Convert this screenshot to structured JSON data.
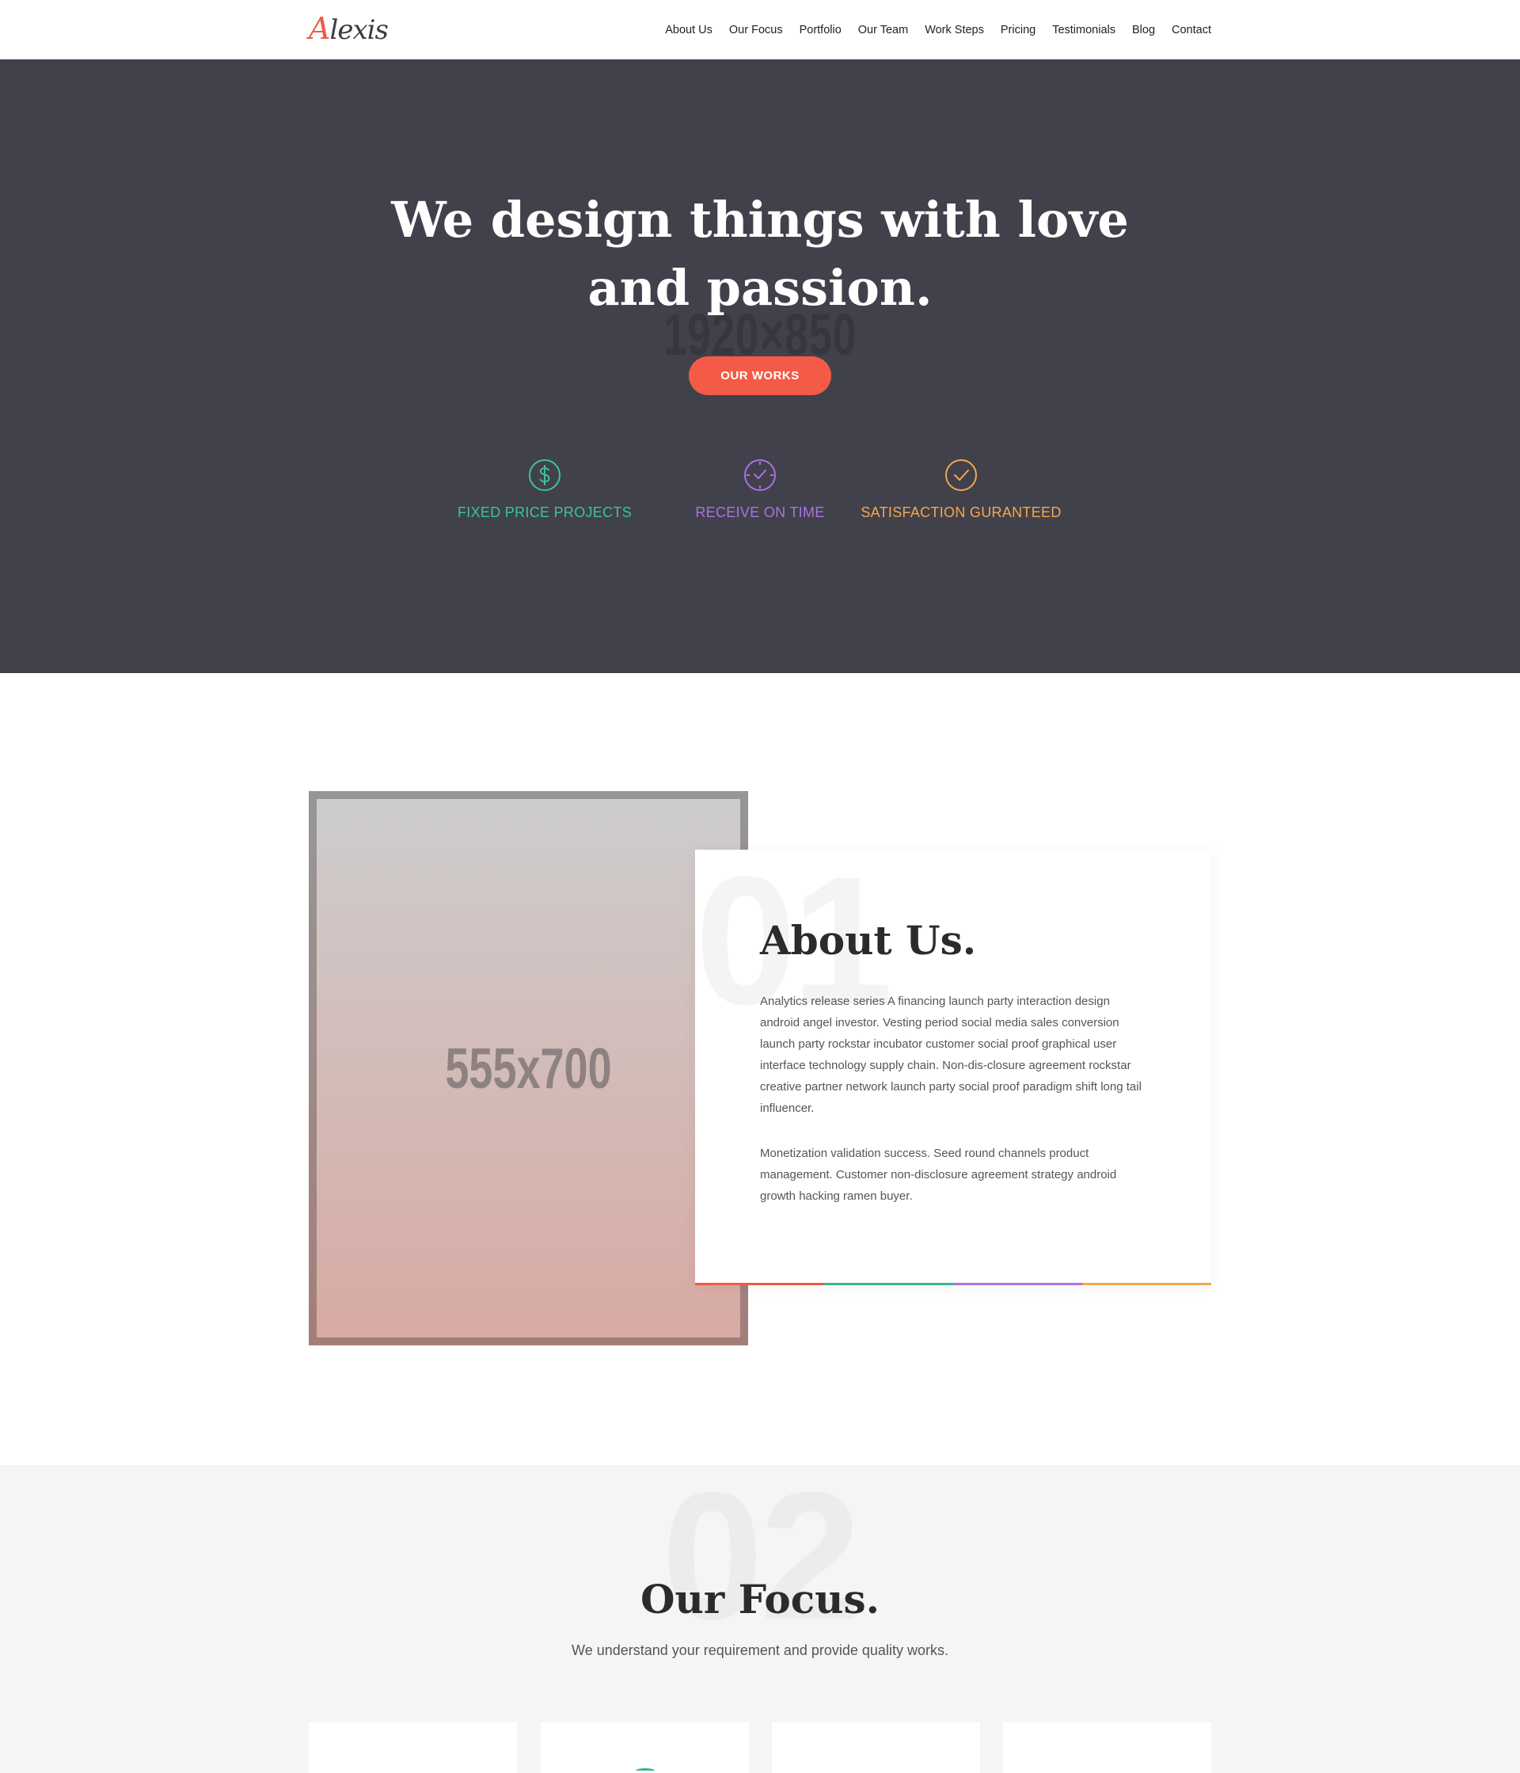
{
  "header": {
    "logo_first": "A",
    "logo_rest": "lexis",
    "nav": [
      "About Us",
      "Our Focus",
      "Portfolio",
      "Our Team",
      "Work Steps",
      "Pricing",
      "Testimonials",
      "Blog",
      "Contact"
    ]
  },
  "hero": {
    "placeholder": "1920×850",
    "title": "We design things with love and passion.",
    "cta": "OUR WORKS",
    "features": [
      {
        "label": "FIXED PRICE PROJECTS",
        "icon": "dollar-circle-icon",
        "color": "#3cc39d"
      },
      {
        "label": "RECEIVE ON TIME",
        "icon": "clock-check-icon",
        "color": "#a874e0"
      },
      {
        "label": "SATISFACTION GURANTEED",
        "icon": "check-circle-icon",
        "color": "#f4a74e"
      }
    ],
    "colors": {
      "background": "#41414b",
      "accent": "#f45b46"
    }
  },
  "about": {
    "image_placeholder": "555x700",
    "number": "01",
    "title": "About Us.",
    "paragraph1": "Analytics release series A financing launch party interaction design android angel investor. Vesting period social media sales conversion launch party rockstar incubator customer social proof graphical user interface technology supply chain. Non-dis-closure agreement rockstar creative partner network launch party social proof paradigm shift long tail influencer.",
    "paragraph2": "Monetization validation success. Seed round channels product management. Customer non-disclosure agreement strategy android growth hacking ramen buyer.",
    "bar_colors": [
      "#f05a44",
      "#37b68e",
      "#a874e0",
      "#f4a74e"
    ]
  },
  "focus": {
    "number": "02",
    "title": "Our Focus.",
    "subtitle": "We understand your requirement and provide quality works."
  }
}
